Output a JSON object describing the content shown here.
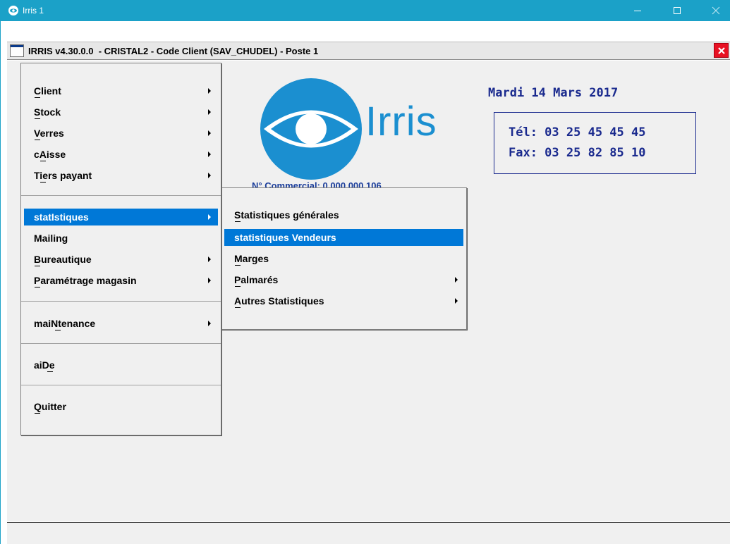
{
  "os_window": {
    "title": "Irris 1",
    "controls": [
      "minimize",
      "maximize",
      "close"
    ]
  },
  "mdi_window": {
    "title": "IRRIS v4.30.0.0  - CRISTAL2 - Code Client (SAV_CHUDEL) - Poste 1"
  },
  "brand": {
    "logo_text": "Irris",
    "license_text": "N° Commercial: 0 000 000 106"
  },
  "info": {
    "date": "Mardi 14 Mars 2017",
    "tel": "Tél: 03 25 45 45 45",
    "fax": "Fax: 03 25 82 85 10"
  },
  "main_menu": {
    "items": [
      {
        "label": "Client",
        "has_submenu": true
      },
      {
        "label": "Stock",
        "has_submenu": true
      },
      {
        "label": "Verres",
        "has_submenu": true
      },
      {
        "label": "cAisse",
        "has_submenu": true
      },
      {
        "label": "Tiers payant",
        "has_submenu": true
      },
      {
        "label": "statIstiques",
        "has_submenu": true,
        "selected": true
      },
      {
        "label": "Mailing",
        "has_submenu": false
      },
      {
        "label": "Bureautique",
        "has_submenu": true
      },
      {
        "label": "Paramétrage magasin",
        "has_submenu": true
      },
      {
        "label": "maiNtenance",
        "has_submenu": true
      },
      {
        "label": "aiDe",
        "has_submenu": false
      },
      {
        "label": "Quitter",
        "has_submenu": false
      }
    ]
  },
  "stats_submenu": {
    "items": [
      {
        "label": "Statistiques générales",
        "has_submenu": false
      },
      {
        "label": "statistiques Vendeurs",
        "has_submenu": false,
        "selected": true
      },
      {
        "label": "Marges",
        "has_submenu": false
      },
      {
        "label": "Palmarés",
        "has_submenu": true
      },
      {
        "label": "Autres Statistiques",
        "has_submenu": true
      }
    ]
  },
  "colors": {
    "os_titlebar": "#1ba1c8",
    "selection": "#0078d7",
    "logo_blue": "#1b8fd0",
    "info_text": "#1a2a8e",
    "close_red": "#e81123"
  }
}
